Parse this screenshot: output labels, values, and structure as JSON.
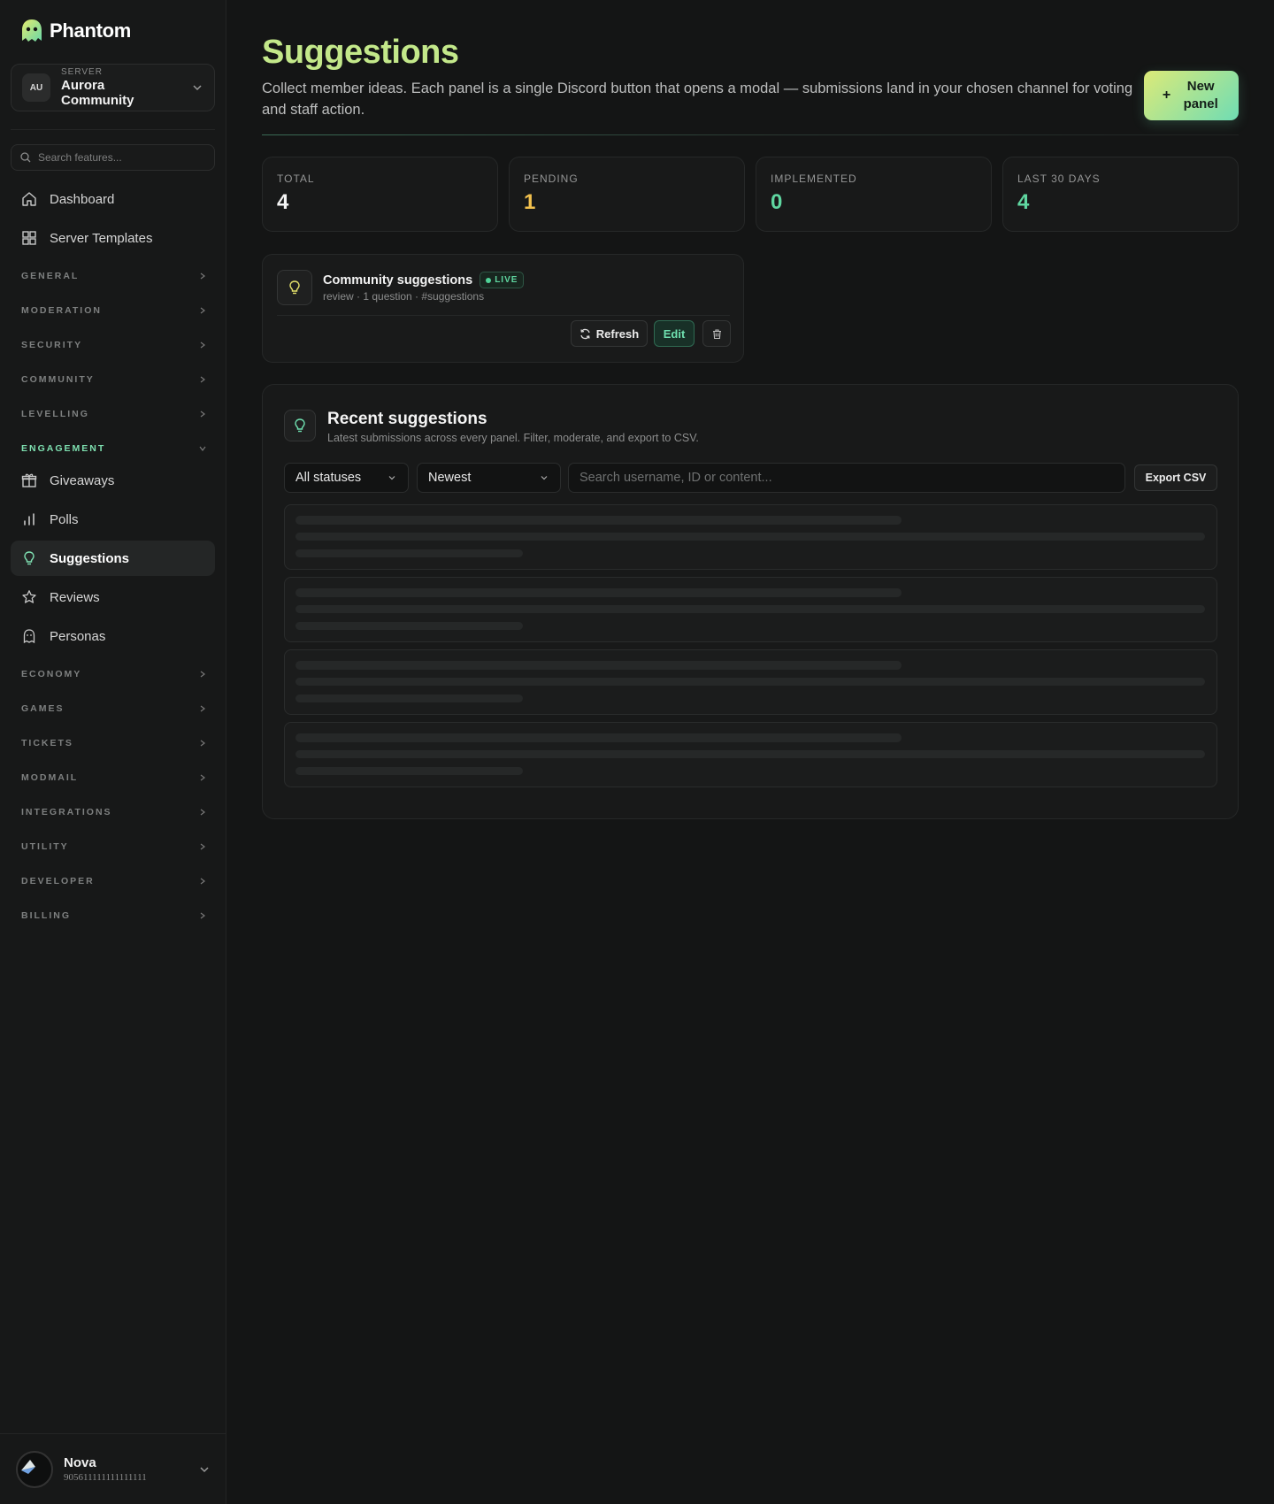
{
  "brand": {
    "name": "Phantom"
  },
  "server": {
    "initials": "AU",
    "caption": "SERVER",
    "name": "Aurora Community"
  },
  "sidebar": {
    "search_placeholder": "Search features...",
    "top_items": [
      {
        "label": "Dashboard",
        "icon": "home-icon"
      },
      {
        "label": "Server Templates",
        "icon": "grid-icon"
      }
    ],
    "sections": [
      "GENERAL",
      "MODERATION",
      "SECURITY",
      "COMMUNITY",
      "LEVELLING",
      "ENGAGEMENT",
      "ECONOMY",
      "GAMES",
      "TICKETS",
      "MODMAIL",
      "INTEGRATIONS",
      "UTILITY",
      "DEVELOPER",
      "BILLING"
    ],
    "engagement_items": [
      {
        "label": "Giveaways",
        "icon": "gift-icon"
      },
      {
        "label": "Polls",
        "icon": "bar-chart-icon"
      },
      {
        "label": "Suggestions",
        "icon": "lightbulb-icon",
        "active": true
      },
      {
        "label": "Reviews",
        "icon": "star-icon"
      },
      {
        "label": "Personas",
        "icon": "ghost-icon"
      }
    ]
  },
  "user": {
    "name": "Nova",
    "id": "905611111111111111"
  },
  "page": {
    "title": "Suggestions",
    "description": "Collect member ideas. Each panel is a single Discord button that opens a modal — submissions land in your chosen channel for voting and staff action.",
    "new_panel_plus": "+",
    "new_panel_label": "New panel"
  },
  "stats": [
    {
      "label": "TOTAL",
      "value": "4",
      "color": "#f4f4f4"
    },
    {
      "label": "PENDING",
      "value": "1",
      "color": "#f2c14e"
    },
    {
      "label": "IMPLEMENTED",
      "value": "0",
      "color": "#5fd6a0"
    },
    {
      "label": "LAST 30 DAYS",
      "value": "4",
      "color": "#5fd6a0"
    }
  ],
  "panel": {
    "name": "Community suggestions",
    "badge": "LIVE",
    "meta": "review · 1 question · #suggestions",
    "refresh_label": "Refresh",
    "edit_label": "Edit"
  },
  "recent": {
    "title": "Recent suggestions",
    "subtitle": "Latest submissions across every panel. Filter, moderate, and export to CSV.",
    "status_filter": "All statuses",
    "sort": "Newest",
    "search_placeholder": "Search username, ID or content...",
    "export_label": "Export CSV"
  },
  "colors": {
    "accent": "#5fd6a0",
    "title_gradient_start": "#dcea78",
    "title_gradient_end": "#6fdcb4"
  }
}
